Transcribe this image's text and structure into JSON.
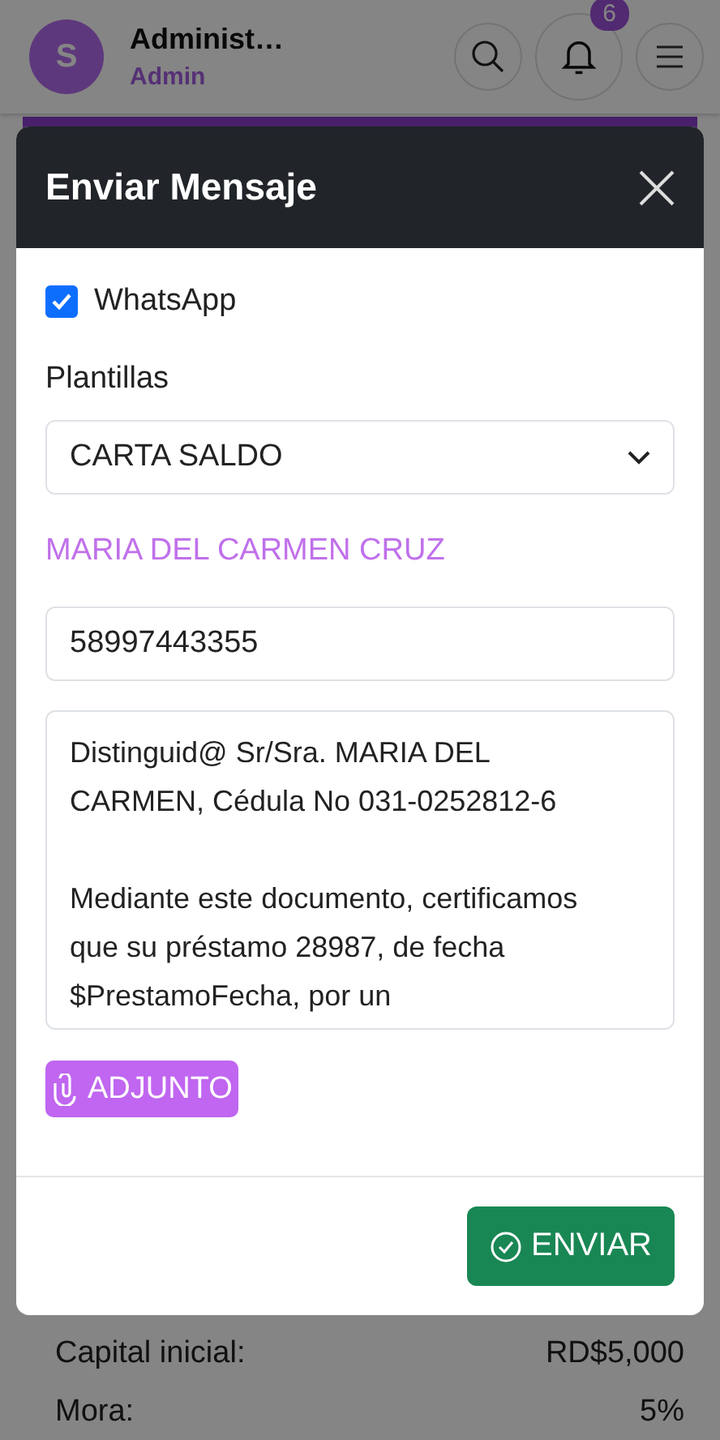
{
  "header": {
    "avatar_initial": "S",
    "user_name": "Administ…",
    "role": "Admin",
    "notification_count": "6"
  },
  "modal": {
    "title": "Enviar Mensaje",
    "whatsapp": {
      "label": "WhatsApp",
      "checked": true
    },
    "template_label": "Plantillas",
    "template_value": "CARTA SALDO",
    "recipient_name": "MARIA DEL CARMEN CRUZ",
    "phone_value": "58997443355",
    "message_value": "Distinguid@ Sr/Sra. MARIA DEL CARMEN, Cédula No 031-0252812-6\n\nMediante este documento, certificamos que su préstamo 28987, de fecha $PrestamoFecha, por un",
    "attach_button": "ADJUNTO",
    "send_button": "ENVIAR"
  },
  "background_rows": [
    {
      "label": "Capital inicial:",
      "value": "RD$5,000"
    },
    {
      "label": "Mora:",
      "value": "5%"
    }
  ]
}
